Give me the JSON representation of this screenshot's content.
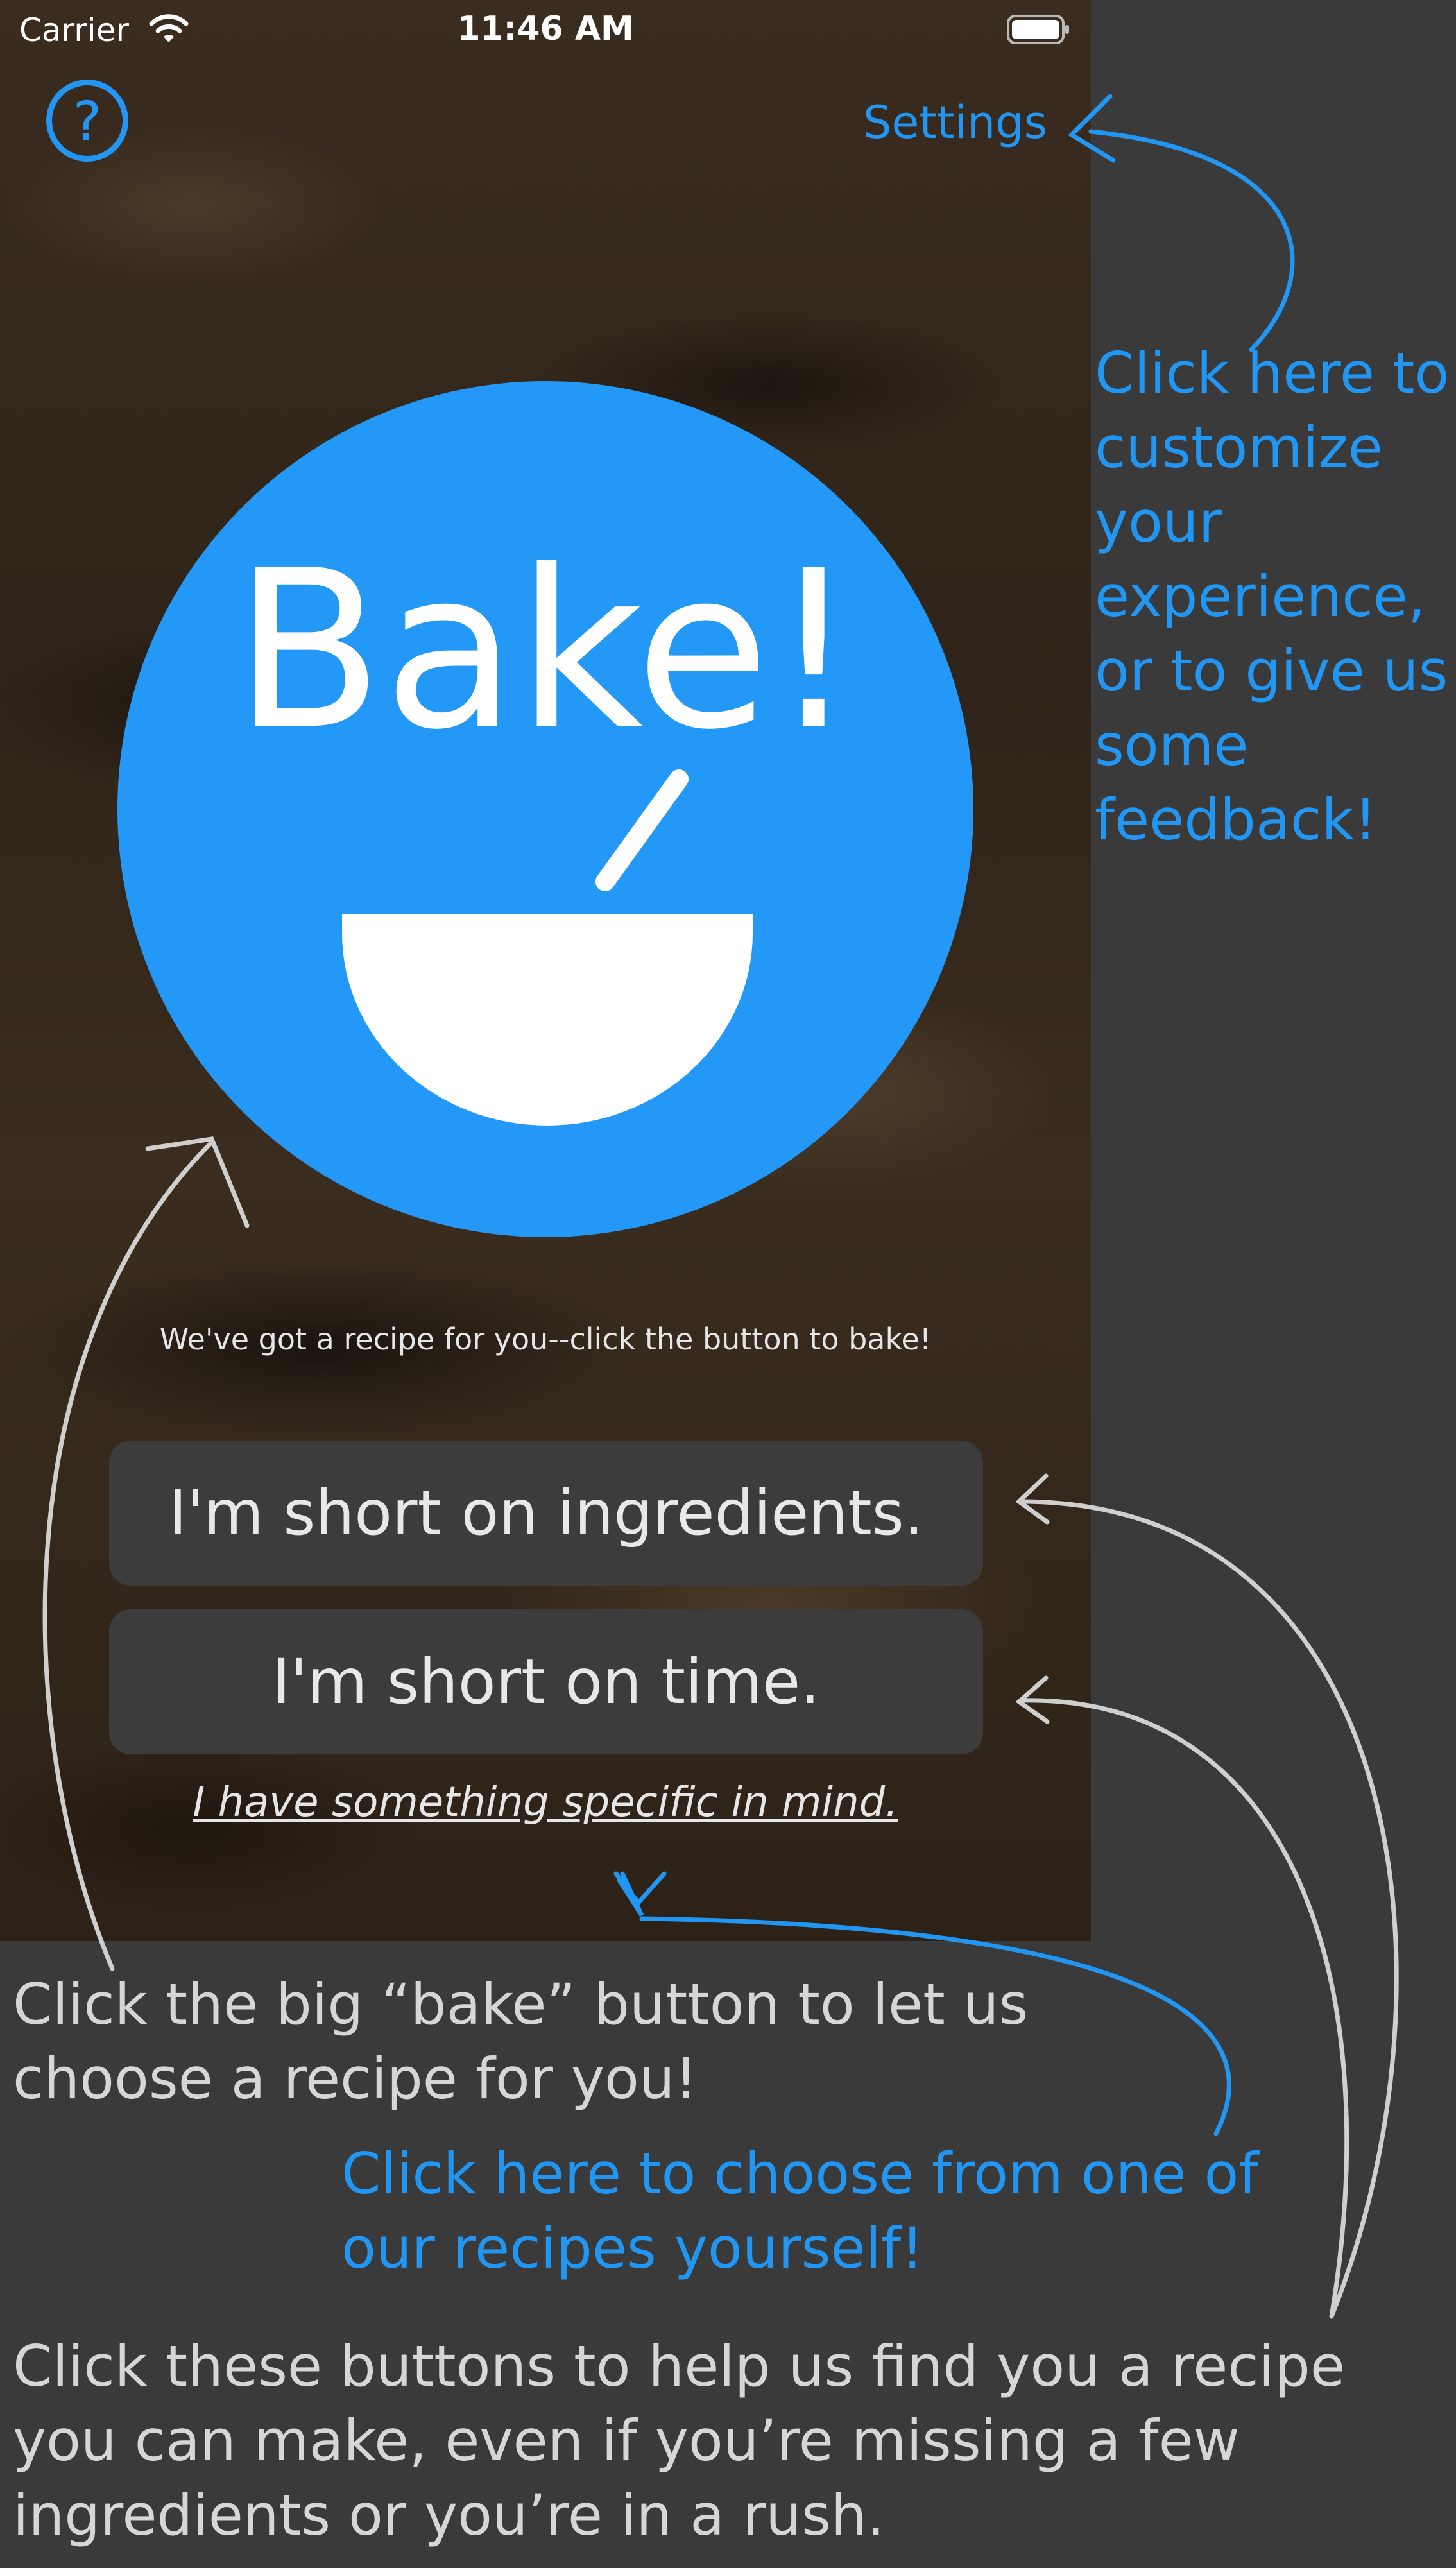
{
  "status_bar": {
    "carrier": "Carrier",
    "time": "11:46 AM"
  },
  "nav": {
    "help_label": "?",
    "settings_label": "Settings"
  },
  "main": {
    "bake_label": "Bake!",
    "tagline": "We've got a recipe for you--click the button to bake!",
    "short_ingredients_label": "I'm short on ingredients.",
    "short_time_label": "I'm short on time.",
    "specific_link_label": "I have something specific in mind."
  },
  "annotations": {
    "settings_note": "Click here to customize your experience, or to give us some feedback!",
    "bake_note": "Click the big “bake” button to let us choose a recipe for you!",
    "specific_note": "Click here to choose from one of our recipes yourself!",
    "buttons_note": "Click these buttons to help us find you a recipe you can make, even if you’re missing a few ingredients or you’re in a rush."
  },
  "colors": {
    "accent": "#2196f3",
    "bake_circle": "#2398f6",
    "button_bg": "#3d3c3c",
    "canvas_bg": "#3b3a3a"
  }
}
